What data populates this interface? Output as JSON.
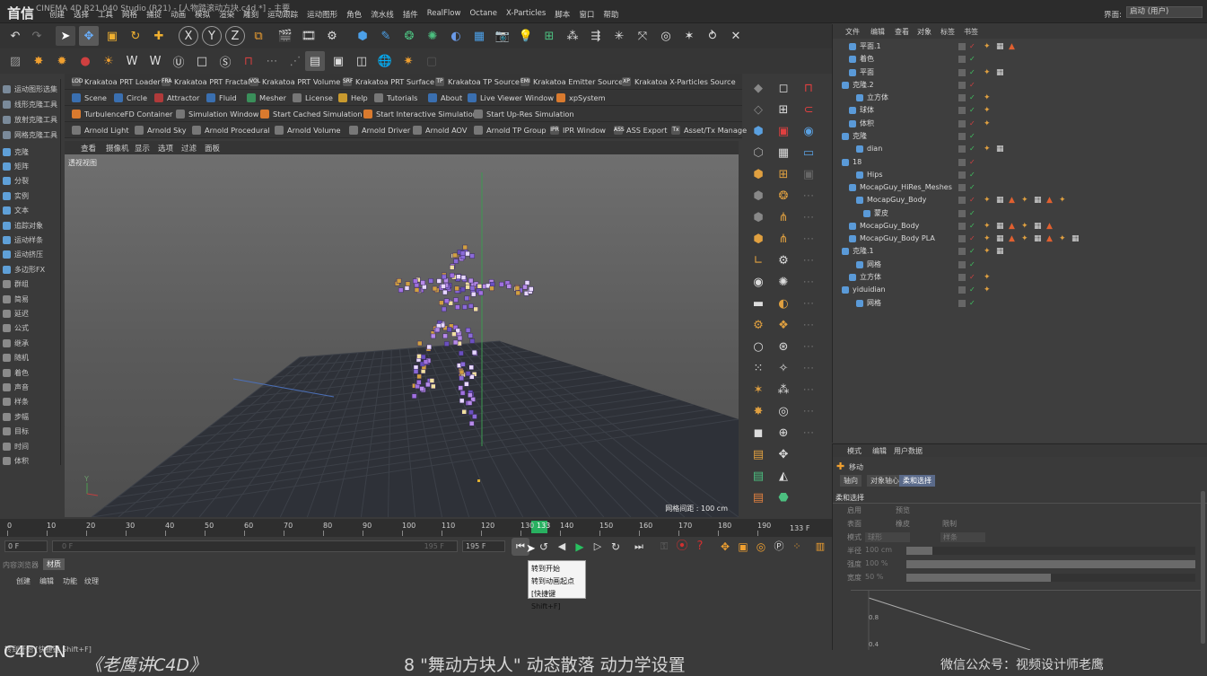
{
  "window": {
    "logo": "首信",
    "title": "CINEMA 4D R21.040 Studio (R21) - [人物踏滚动方块.c4d *] - 主要",
    "layout_label": "界面:",
    "layout_value": "启动 (用户)"
  },
  "menu": [
    "创建",
    "选择",
    "工具",
    "网格",
    "捕捉",
    "动画",
    "模拟",
    "渲染",
    "雕刻",
    "运动跟踪",
    "运动图形",
    "角色",
    "流水线",
    "插件",
    "RealFlow",
    "Octane",
    "X-Particles",
    "脚本",
    "窗口",
    "帮助"
  ],
  "left_tools": [
    {
      "label": "运动图形选集",
      "color": "#7a8a9a"
    },
    {
      "label": "线形克隆工具",
      "color": "#7a8a9a"
    },
    {
      "label": "放射克隆工具",
      "color": "#7a8a9a"
    },
    {
      "label": "网格克隆工具",
      "color": "#7a8a9a"
    },
    {
      "label": "克隆",
      "color": "#5fa0d8"
    },
    {
      "label": "矩阵",
      "color": "#5fa0d8"
    },
    {
      "label": "分裂",
      "color": "#5fa0d8"
    },
    {
      "label": "实例",
      "color": "#5fa0d8"
    },
    {
      "label": "文本",
      "color": "#5fa0d8"
    },
    {
      "label": "追踪对象",
      "color": "#5fa0d8"
    },
    {
      "label": "运动样条",
      "color": "#5fa0d8"
    },
    {
      "label": "运动挤压",
      "color": "#5fa0d8"
    },
    {
      "label": "多边形FX",
      "color": "#5fa0d8"
    },
    {
      "label": "群组",
      "color": "#8a8a8a"
    },
    {
      "label": "简易",
      "color": "#8a8a8a"
    },
    {
      "label": "延迟",
      "color": "#8a8a8a"
    },
    {
      "label": "公式",
      "color": "#8a8a8a"
    },
    {
      "label": "继承",
      "color": "#8a8a8a"
    },
    {
      "label": "随机",
      "color": "#8a8a8a"
    },
    {
      "label": "着色",
      "color": "#8a8a8a"
    },
    {
      "label": "声音",
      "color": "#8a8a8a"
    },
    {
      "label": "样条",
      "color": "#8a8a8a"
    },
    {
      "label": "步幅",
      "color": "#8a8a8a"
    },
    {
      "label": "目标",
      "color": "#8a8a8a"
    },
    {
      "label": "时间",
      "color": "#8a8a8a"
    },
    {
      "label": "体积",
      "color": "#8a8a8a"
    }
  ],
  "plugin_rows": [
    [
      {
        "label": "Krakatoa PRT Loader",
        "icon": "LOD",
        "color": "#555"
      },
      {
        "label": "Krakatoa PRT Fractal",
        "icon": "FRA",
        "color": "#555"
      },
      {
        "label": "Krakatoa PRT Volume",
        "icon": "VOL",
        "color": "#555"
      },
      {
        "label": "Krakatoa PRT Surface",
        "icon": "SRF",
        "color": "#555"
      },
      {
        "label": "Krakatoa TP Source",
        "icon": "TP",
        "color": "#555"
      },
      {
        "label": "Krakatoa Emitter Source",
        "icon": "EMI",
        "color": "#555"
      },
      {
        "label": "Krakatoa X-Particles Source",
        "icon": "XP",
        "color": "#555"
      }
    ],
    [
      {
        "label": "Scene",
        "icon": "",
        "color": "#3a6fb0"
      },
      {
        "label": "Circle",
        "icon": "",
        "color": "#3a6fb0"
      },
      {
        "label": "Attractor",
        "icon": "",
        "color": "#b03a3a"
      },
      {
        "label": "Fluid",
        "icon": "",
        "color": "#3a6fb0"
      },
      {
        "label": "Mesher",
        "icon": "",
        "color": "#3a8f5a"
      },
      {
        "label": "License",
        "icon": "",
        "color": "#777"
      },
      {
        "label": "Help",
        "icon": "",
        "color": "#c99a2e"
      },
      {
        "label": "Tutorials",
        "icon": "",
        "color": "#777"
      },
      {
        "label": "About",
        "icon": "",
        "color": "#3a6fb0"
      },
      {
        "label": "Live Viewer Window",
        "icon": "",
        "color": "#3a6fb0"
      },
      {
        "label": "xpSystem",
        "icon": "",
        "color": "#d97a2e"
      }
    ],
    [
      {
        "label": "TurbulenceFD Container",
        "icon": "",
        "color": "#d97a2e"
      },
      {
        "label": "Simulation Window",
        "icon": "",
        "color": "#777"
      },
      {
        "label": "Start Cached Simulation",
        "icon": "",
        "color": "#d97a2e"
      },
      {
        "label": "Start Interactive Simulation",
        "icon": "",
        "color": "#d97a2e"
      },
      {
        "label": "Start Up-Res Simulation",
        "icon": "",
        "color": "#777"
      }
    ],
    [
      {
        "label": "Arnold Light",
        "icon": "",
        "color": "#777"
      },
      {
        "label": "Arnold Sky",
        "icon": "",
        "color": "#777"
      },
      {
        "label": "Arnold Procedural",
        "icon": "",
        "color": "#777"
      },
      {
        "label": "Arnold Volume",
        "icon": "",
        "color": "#777"
      },
      {
        "label": "Arnold Driver",
        "icon": "",
        "color": "#777"
      },
      {
        "label": "Arnold AOV",
        "icon": "",
        "color": "#777"
      },
      {
        "label": "Arnold TP Group",
        "icon": "",
        "color": "#777"
      },
      {
        "label": "IPR Window",
        "icon": "IPR",
        "color": "#555"
      },
      {
        "label": "ASS Export",
        "icon": "ASS",
        "color": "#555"
      },
      {
        "label": "Asset/Tx Manager",
        "icon": "Tx",
        "color": "#555"
      }
    ]
  ],
  "viewport": {
    "menu": [
      "查看",
      "摄像机",
      "显示",
      "选项",
      "过滤",
      "面板"
    ],
    "name": "透视视图",
    "grid_spacing": "网格间距 : 100 cm"
  },
  "object_panel": {
    "menu": [
      "文件",
      "编辑",
      "查看",
      "对象",
      "标签",
      "书签"
    ],
    "rows": [
      {
        "label": "平面.1",
        "indent": 1,
        "tags": 3
      },
      {
        "label": "着色",
        "indent": 1,
        "tags": 0
      },
      {
        "label": "平面",
        "indent": 1,
        "tags": 2
      },
      {
        "label": "克隆.2",
        "indent": 0,
        "tags": 0
      },
      {
        "label": "立方体",
        "indent": 2,
        "tags": 1
      },
      {
        "label": "球体",
        "indent": 1,
        "tags": 1
      },
      {
        "label": "体积",
        "indent": 1,
        "tags": 1
      },
      {
        "label": "克隆",
        "indent": 0,
        "tags": 0
      },
      {
        "label": "dian",
        "indent": 2,
        "tags": 2
      },
      {
        "label": "18",
        "indent": 0,
        "tags": 0
      },
      {
        "label": "Hips",
        "indent": 2,
        "tags": 0
      },
      {
        "label": "MocapGuy_HiRes_Meshes",
        "indent": 1,
        "tags": 0
      },
      {
        "label": "MocapGuy_Body",
        "indent": 2,
        "tags": 7
      },
      {
        "label": "蒙皮",
        "indent": 3,
        "tags": 0
      },
      {
        "label": "MocapGuy_Body",
        "indent": 1,
        "tags": 6
      },
      {
        "label": "MocapGuy_Body PLA",
        "indent": 1,
        "tags": 8
      },
      {
        "label": "克隆.1",
        "indent": 0,
        "tags": 2
      },
      {
        "label": "网格",
        "indent": 2,
        "tags": 0
      },
      {
        "label": "立方体",
        "indent": 1,
        "tags": 1
      },
      {
        "label": "yiduidian",
        "indent": 0,
        "tags": 1
      },
      {
        "label": "网格",
        "indent": 2,
        "tags": 0
      }
    ]
  },
  "attr_panel": {
    "menu": [
      "模式",
      "编辑",
      "用户数据"
    ],
    "object": "移动",
    "tabs": [
      "轴向",
      "对象轴心",
      "柔和选择"
    ],
    "section": "柔和选择",
    "rows": [
      {
        "a": "启用",
        "b": "预览"
      },
      {
        "a": "表面",
        "b": "橡皮",
        "c": "限制"
      },
      {
        "a": "模式",
        "a_val": "球形",
        "b": "衰减",
        "b_val": "样条"
      }
    ],
    "sliders": [
      {
        "label": "半径",
        "value": "100 cm",
        "fill": 0.09
      },
      {
        "label": "强度",
        "value": "100 %",
        "fill": 1.0
      },
      {
        "label": "宽度",
        "value": "50 %",
        "fill": 0.5
      }
    ],
    "graph_ticks": [
      "0.8",
      "0.4"
    ]
  },
  "timeline": {
    "ticks": [
      "0",
      "10",
      "20",
      "30",
      "40",
      "50",
      "60",
      "70",
      "80",
      "90",
      "100",
      "110",
      "120",
      "130",
      "140",
      "150",
      "160",
      "170",
      "180",
      "190"
    ],
    "current": "133",
    "end_frame": "133 F",
    "start_field": "0 F",
    "range_start": "0 F",
    "range_end": "195 F",
    "max_field": "195 F"
  },
  "tooltip": {
    "line1": "转到开始",
    "line2": "转到动画起点",
    "line3": "[快捷键 Shift+F]"
  },
  "bottom": {
    "tabs": [
      "内容浏览器",
      "材质"
    ],
    "menu": [
      "创建",
      "编辑",
      "功能",
      "纹理"
    ],
    "status": "转到开始 [快捷键 Shift+F]"
  },
  "watermark": "C4D.CN",
  "caption_left": "《老鹰讲C4D》",
  "caption_mid": "8 \"舞动方块人\" 动态散落  动力学设置",
  "caption_right": "微信公众号：视频设计师老鹰"
}
